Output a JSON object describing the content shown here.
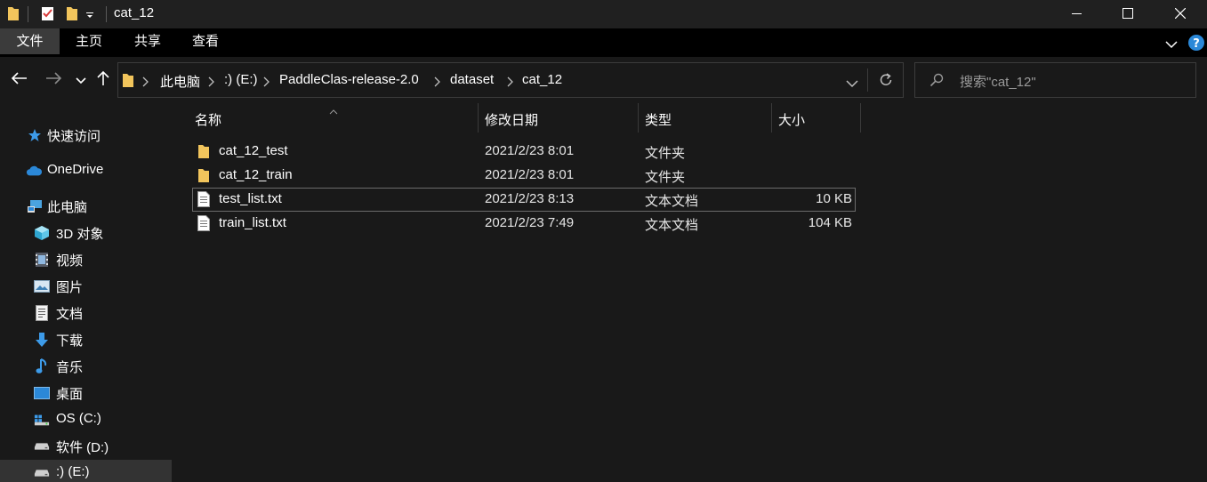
{
  "window": {
    "title": "cat_12",
    "icons": [
      "folder-icon",
      "properties-icon",
      "new-folder-icon",
      "customize-qat-icon"
    ],
    "controls": [
      "minimize-icon",
      "maximize-icon",
      "close-icon"
    ]
  },
  "ribbon": {
    "tabs": [
      {
        "label": "文件",
        "active": true
      },
      {
        "label": "主页",
        "active": false
      },
      {
        "label": "共享",
        "active": false
      },
      {
        "label": "查看",
        "active": false
      }
    ],
    "help_icon": "help-icon",
    "expand_icon": "chevron-down-icon"
  },
  "nav": {
    "back_icon": "back-arrow-icon",
    "forward_icon": "forward-arrow-icon",
    "recent_icon": "chevron-down-icon",
    "up_icon": "up-arrow-icon",
    "breadcrumbs": [
      "此电脑",
      ":) (E:)",
      "PaddleClas-release-2.0",
      "dataset",
      "cat_12"
    ],
    "refresh_icon": "refresh-icon",
    "search_placeholder": "搜索\"cat_12\""
  },
  "sidebar": {
    "items": [
      {
        "label": "快速访问",
        "icon": "star-icon"
      },
      {
        "label": "OneDrive",
        "icon": "cloud-icon"
      },
      {
        "label": "此电脑",
        "icon": "computer-icon"
      },
      {
        "label": "3D 对象",
        "icon": "cube-icon"
      },
      {
        "label": "视频",
        "icon": "video-icon"
      },
      {
        "label": "图片",
        "icon": "picture-icon"
      },
      {
        "label": "文档",
        "icon": "document-icon"
      },
      {
        "label": "下载",
        "icon": "download-icon"
      },
      {
        "label": "音乐",
        "icon": "music-icon"
      },
      {
        "label": "桌面",
        "icon": "desktop-icon"
      },
      {
        "label": "OS (C:)",
        "icon": "windows-drive-icon"
      },
      {
        "label": "软件 (D:)",
        "icon": "drive-icon"
      },
      {
        "label": ":) (E:)",
        "icon": "drive-icon",
        "selected": true
      }
    ]
  },
  "files": {
    "columns": [
      "名称",
      "修改日期",
      "类型",
      "大小"
    ],
    "rows": [
      {
        "name": "cat_12_test",
        "date": "2021/2/23 8:01",
        "type": "文件夹",
        "size": "",
        "icon": "folder-icon"
      },
      {
        "name": "cat_12_train",
        "date": "2021/2/23 8:01",
        "type": "文件夹",
        "size": "",
        "icon": "folder-icon"
      },
      {
        "name": "test_list.txt",
        "date": "2021/2/23 8:13",
        "type": "文本文档",
        "size": "10 KB",
        "icon": "text-file-icon"
      },
      {
        "name": "train_list.txt",
        "date": "2021/2/23 7:49",
        "type": "文本文档",
        "size": "104 KB",
        "icon": "text-file-icon"
      }
    ]
  },
  "colors": {
    "folder": "#f2c55c",
    "accent": "#2b88d8"
  }
}
